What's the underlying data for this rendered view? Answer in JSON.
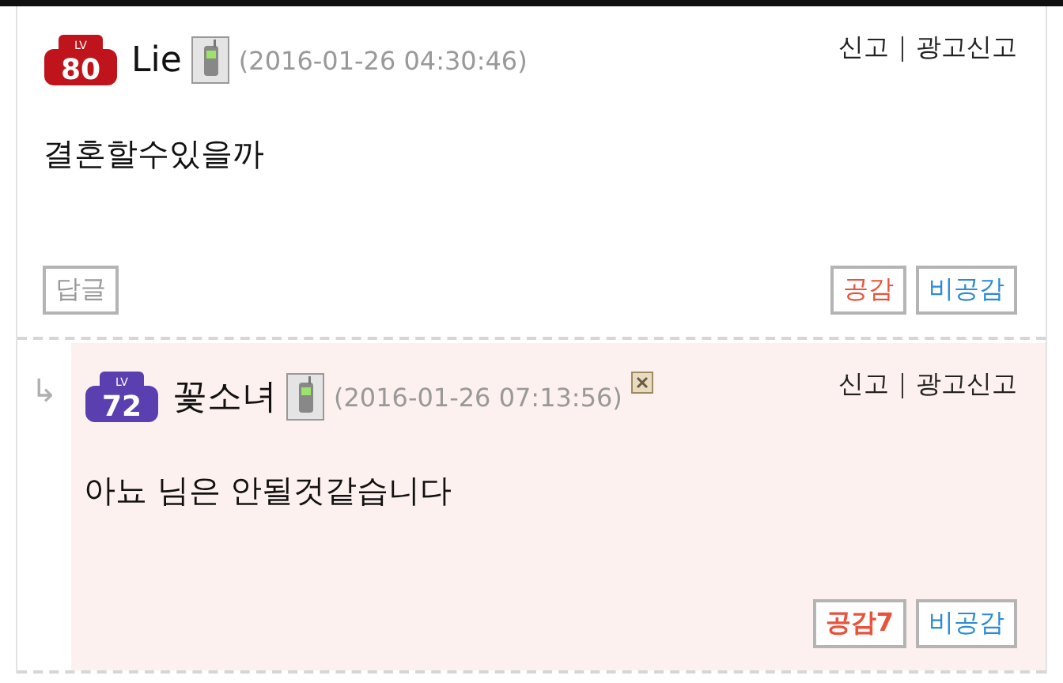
{
  "comments": [
    {
      "kind": "comment",
      "badge": {
        "label": "LV",
        "number": "80",
        "color": "#c0141c"
      },
      "author": "Lie",
      "date": "(2016-01-26 04:30:46)",
      "deletable": false,
      "report_links": [
        "신고",
        "광고신고"
      ],
      "body": "결혼할수있을까",
      "reply_button": "답글",
      "like": {
        "label": "공감",
        "active": false
      },
      "dislike": "비공감"
    },
    {
      "kind": "reply",
      "arrow": "↳",
      "badge": {
        "label": "LV",
        "number": "72",
        "color": "#5a3fb0"
      },
      "author": "꽃소녀",
      "date": "(2016-01-26 07:13:56)",
      "deletable": true,
      "report_links": [
        "신고",
        "광고신고"
      ],
      "body": "아뇨 님은 안될것같습니다",
      "like": {
        "label": "공감7",
        "active": true
      },
      "dislike": "비공감"
    }
  ]
}
